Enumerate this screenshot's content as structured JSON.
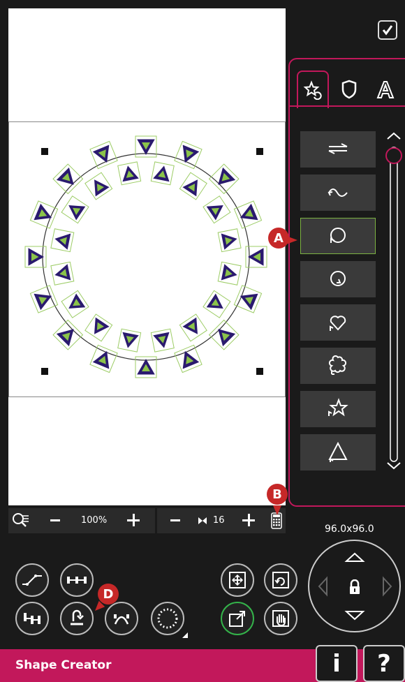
{
  "header": {
    "confirm_icon": "checkmark-icon"
  },
  "tabs": [
    {
      "icon": "star-undo-icon"
    },
    {
      "icon": "shield-outline-icon"
    },
    {
      "icon": "letter-a-outline-icon"
    }
  ],
  "shapes": [
    {
      "icon": "line-arrows-icon"
    },
    {
      "icon": "wave-arrow-icon"
    },
    {
      "icon": "circle-arrow-icon",
      "selected": true
    },
    {
      "icon": "circle-small-arrow-icon"
    },
    {
      "icon": "heart-arrow-icon"
    },
    {
      "icon": "flower-arrow-icon"
    },
    {
      "icon": "star-arrow-icon"
    },
    {
      "icon": "triangle-arrow-icon"
    }
  ],
  "zoom_bar": {
    "zoom_value": "100%",
    "repeat_count": "16"
  },
  "position": {
    "size_label": "96.0x96.0"
  },
  "footer": {
    "title": "Shape Creator",
    "info_label": "i",
    "help_label": "?"
  },
  "callouts": {
    "a": "A",
    "b": "B",
    "d": "D"
  },
  "colors": {
    "accent": "#c2185b",
    "selection_green": "#34b34a",
    "stitch_purple": "#2a1a6e",
    "stitch_green": "#8bc34a"
  }
}
